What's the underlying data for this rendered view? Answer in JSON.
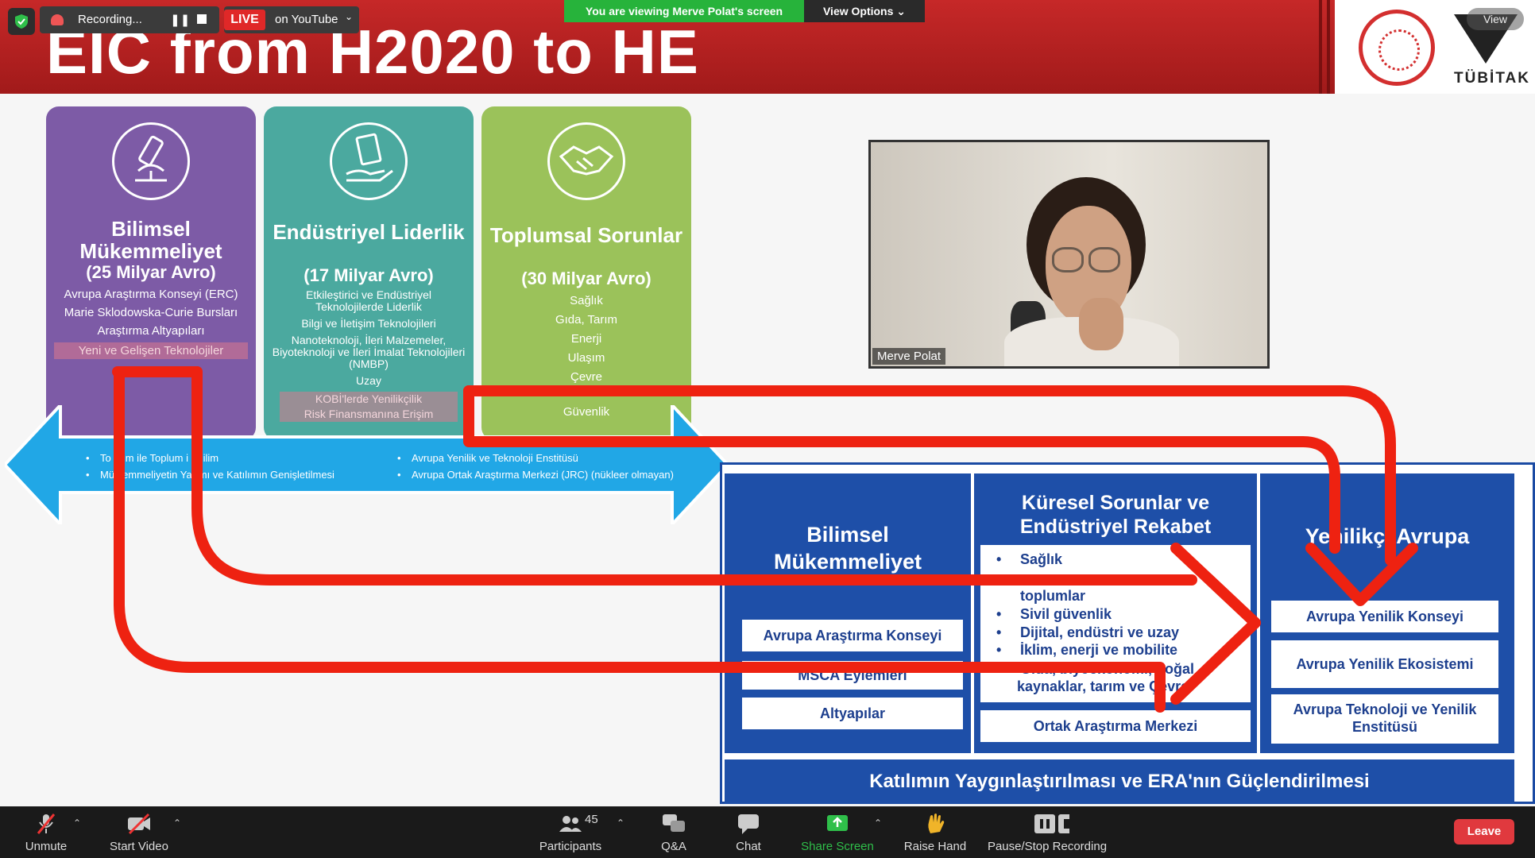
{
  "slide": {
    "title": "EIC from H2020 to HE",
    "logo_text": "TÜBİTAK",
    "pillars": [
      {
        "title": "Bilimsel Mükemmeliyet",
        "budget": "(25 Milyar Avro)",
        "items": [
          "Avrupa Araştırma Konseyi (ERC)",
          "Marie Sklodowska-Curie Bursları",
          "Araştırma Altyapıları",
          "Yeni ve Gelişen Teknolojiler"
        ]
      },
      {
        "title": "Endüstriyel Liderlik",
        "budget": "(17 Milyar Avro)",
        "items": [
          "Etkileştirici ve Endüstriyel Teknolojilerde Liderlik",
          "Bilgi ve İletişim Teknolojileri",
          "Nanoteknoloji, İleri Malzemeler, Biyoteknoloji ve İleri İmalat Teknolojileri (NMBP)",
          "Uzay",
          "KOBİ'lerde Yenilikçilik",
          "Risk Finansmanına Erişim"
        ]
      },
      {
        "title": "Toplumsal Sorunlar",
        "budget": "(30 Milyar Avro)",
        "items": [
          "Sağlık",
          "Gıda, Tarım",
          "Enerji",
          "Ulaşım",
          "Çevre",
          "Güvenlik"
        ]
      }
    ],
    "cyan_left": [
      "Toplum ile Toplum için Bilim",
      "Mükemmeliyetin Yayılımı ve Katılımın Genişletilmesi"
    ],
    "cyan_left_visible": [
      "To",
      "m ile Toplum i",
      "Bilim",
      "Mü",
      "emmeliyetin Ya",
      "mı ve Katılımın Genişletilmesi"
    ],
    "cyan_right": [
      "Avrupa Yenilik ve Teknoloji Enstitüsü",
      "Avrupa Ortak Araştırma Merkezi (JRC) (nükleer olmayan)"
    ],
    "he": {
      "col1_title": "Bilimsel Mükemmeliyet",
      "col1_items": [
        "Avrupa Araştırma Konseyi",
        "MSCA Eylemleri",
        "Altyapılar"
      ],
      "col2_title": "Küresel Sorunlar ve Endüstriyel Rekabet",
      "col2_items": [
        "Sağlık",
        "Kültür, yaratıcılık ve kapsayıcı",
        "toplumlar",
        "Sivil güvenlik",
        "Dijital, endüstri ve uzay",
        "İklim, enerji ve mobilite",
        "Gıda, biyoekonomi, doğal",
        "kaynaklar, tarım ve Çevre"
      ],
      "col2_bottom": "Ortak Araştırma Merkezi",
      "col3_title": "Yenilikçi Avrupa",
      "col3_items": [
        "Avrupa Yenilik Konseyi",
        "Avrupa Yenilik Ekosistemi",
        "Avrupa Teknoloji ve Yenilik Enstitüsü"
      ],
      "bottom_band": "Katılımın Yaygınlaştırılması ve ERA'nın Güçlendirilmesi"
    }
  },
  "zoom_top": {
    "recording": "Recording...",
    "live": "LIVE",
    "live_target": "on YouTube",
    "viewing": "You are viewing Merve Polat's screen",
    "view_options": "View Options",
    "view_badge": "View"
  },
  "video": {
    "name": "Merve Polat"
  },
  "toolbar": {
    "unmute": "Unmute",
    "start_video": "Start Video",
    "participants": "Participants",
    "participants_count": "45",
    "qa": "Q&A",
    "chat": "Chat",
    "share": "Share Screen",
    "raise": "Raise Hand",
    "pause_rec": "Pause/Stop Recording",
    "leave": "Leave"
  },
  "colors": {
    "zoom_green": "#27b33b",
    "leave_red": "#e0393e",
    "slide_red": "#c62828",
    "he_blue": "#1e4fa8",
    "annotation_red": "#ee2211"
  }
}
